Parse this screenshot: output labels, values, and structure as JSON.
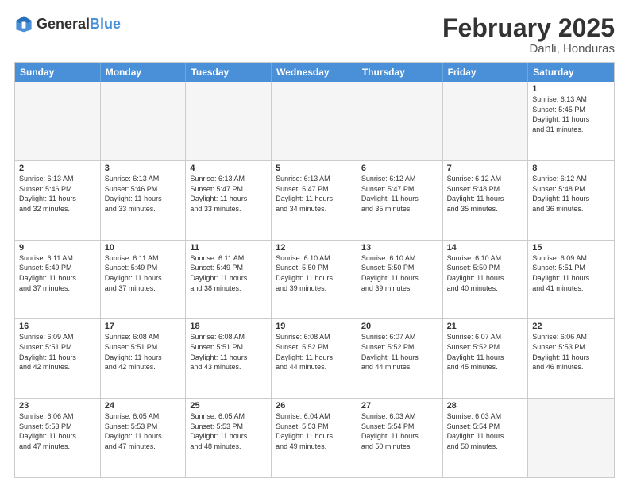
{
  "logo": {
    "general": "General",
    "blue": "Blue"
  },
  "header": {
    "month_year": "February 2025",
    "location": "Danli, Honduras"
  },
  "day_headers": [
    "Sunday",
    "Monday",
    "Tuesday",
    "Wednesday",
    "Thursday",
    "Friday",
    "Saturday"
  ],
  "weeks": [
    [
      {
        "day": "",
        "info": "",
        "empty": true
      },
      {
        "day": "",
        "info": "",
        "empty": true
      },
      {
        "day": "",
        "info": "",
        "empty": true
      },
      {
        "day": "",
        "info": "",
        "empty": true
      },
      {
        "day": "",
        "info": "",
        "empty": true
      },
      {
        "day": "",
        "info": "",
        "empty": true
      },
      {
        "day": "1",
        "info": "Sunrise: 6:13 AM\nSunset: 5:45 PM\nDaylight: 11 hours\nand 31 minutes."
      }
    ],
    [
      {
        "day": "2",
        "info": "Sunrise: 6:13 AM\nSunset: 5:46 PM\nDaylight: 11 hours\nand 32 minutes."
      },
      {
        "day": "3",
        "info": "Sunrise: 6:13 AM\nSunset: 5:46 PM\nDaylight: 11 hours\nand 33 minutes."
      },
      {
        "day": "4",
        "info": "Sunrise: 6:13 AM\nSunset: 5:47 PM\nDaylight: 11 hours\nand 33 minutes."
      },
      {
        "day": "5",
        "info": "Sunrise: 6:13 AM\nSunset: 5:47 PM\nDaylight: 11 hours\nand 34 minutes."
      },
      {
        "day": "6",
        "info": "Sunrise: 6:12 AM\nSunset: 5:47 PM\nDaylight: 11 hours\nand 35 minutes."
      },
      {
        "day": "7",
        "info": "Sunrise: 6:12 AM\nSunset: 5:48 PM\nDaylight: 11 hours\nand 35 minutes."
      },
      {
        "day": "8",
        "info": "Sunrise: 6:12 AM\nSunset: 5:48 PM\nDaylight: 11 hours\nand 36 minutes."
      }
    ],
    [
      {
        "day": "9",
        "info": "Sunrise: 6:11 AM\nSunset: 5:49 PM\nDaylight: 11 hours\nand 37 minutes."
      },
      {
        "day": "10",
        "info": "Sunrise: 6:11 AM\nSunset: 5:49 PM\nDaylight: 11 hours\nand 37 minutes."
      },
      {
        "day": "11",
        "info": "Sunrise: 6:11 AM\nSunset: 5:49 PM\nDaylight: 11 hours\nand 38 minutes."
      },
      {
        "day": "12",
        "info": "Sunrise: 6:10 AM\nSunset: 5:50 PM\nDaylight: 11 hours\nand 39 minutes."
      },
      {
        "day": "13",
        "info": "Sunrise: 6:10 AM\nSunset: 5:50 PM\nDaylight: 11 hours\nand 39 minutes."
      },
      {
        "day": "14",
        "info": "Sunrise: 6:10 AM\nSunset: 5:50 PM\nDaylight: 11 hours\nand 40 minutes."
      },
      {
        "day": "15",
        "info": "Sunrise: 6:09 AM\nSunset: 5:51 PM\nDaylight: 11 hours\nand 41 minutes."
      }
    ],
    [
      {
        "day": "16",
        "info": "Sunrise: 6:09 AM\nSunset: 5:51 PM\nDaylight: 11 hours\nand 42 minutes."
      },
      {
        "day": "17",
        "info": "Sunrise: 6:08 AM\nSunset: 5:51 PM\nDaylight: 11 hours\nand 42 minutes."
      },
      {
        "day": "18",
        "info": "Sunrise: 6:08 AM\nSunset: 5:51 PM\nDaylight: 11 hours\nand 43 minutes."
      },
      {
        "day": "19",
        "info": "Sunrise: 6:08 AM\nSunset: 5:52 PM\nDaylight: 11 hours\nand 44 minutes."
      },
      {
        "day": "20",
        "info": "Sunrise: 6:07 AM\nSunset: 5:52 PM\nDaylight: 11 hours\nand 44 minutes."
      },
      {
        "day": "21",
        "info": "Sunrise: 6:07 AM\nSunset: 5:52 PM\nDaylight: 11 hours\nand 45 minutes."
      },
      {
        "day": "22",
        "info": "Sunrise: 6:06 AM\nSunset: 5:53 PM\nDaylight: 11 hours\nand 46 minutes."
      }
    ],
    [
      {
        "day": "23",
        "info": "Sunrise: 6:06 AM\nSunset: 5:53 PM\nDaylight: 11 hours\nand 47 minutes."
      },
      {
        "day": "24",
        "info": "Sunrise: 6:05 AM\nSunset: 5:53 PM\nDaylight: 11 hours\nand 47 minutes."
      },
      {
        "day": "25",
        "info": "Sunrise: 6:05 AM\nSunset: 5:53 PM\nDaylight: 11 hours\nand 48 minutes."
      },
      {
        "day": "26",
        "info": "Sunrise: 6:04 AM\nSunset: 5:53 PM\nDaylight: 11 hours\nand 49 minutes."
      },
      {
        "day": "27",
        "info": "Sunrise: 6:03 AM\nSunset: 5:54 PM\nDaylight: 11 hours\nand 50 minutes."
      },
      {
        "day": "28",
        "info": "Sunrise: 6:03 AM\nSunset: 5:54 PM\nDaylight: 11 hours\nand 50 minutes."
      },
      {
        "day": "",
        "info": "",
        "empty": true
      }
    ]
  ]
}
